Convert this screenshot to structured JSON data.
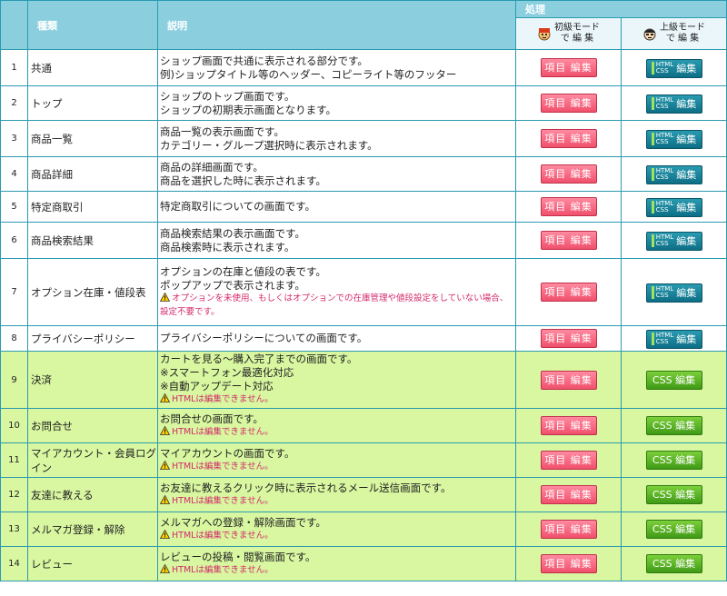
{
  "header": {
    "type": "種類",
    "desc": "説明",
    "process": "処理",
    "beginner": "初級モード\nで 編 集",
    "beginner_l1": "初級モード",
    "beginner_l2": "で 編 集",
    "advanced_l1": "上級モード",
    "advanced_l2": "で 編 集"
  },
  "buttons": {
    "item_edit": "項目 編集",
    "html_tag_1": "HTML",
    "html_tag_2": "CSS",
    "edit": "編集",
    "css_edit": "CSS 編集"
  },
  "rows": [
    {
      "no": "1",
      "type": "共通",
      "desc": [
        "ショップ画面で共通に表示される部分です。",
        "例)ショップタイトル等のヘッダー、コピーライト等のフッター"
      ],
      "warn": "",
      "mode": "html"
    },
    {
      "no": "2",
      "type": "トップ",
      "desc": [
        "ショップのトップ画面です。",
        "ショップの初期表示画面となります。"
      ],
      "warn": "",
      "mode": "html"
    },
    {
      "no": "3",
      "type": "商品一覧",
      "desc": [
        "商品一覧の表示画面です。",
        "カテゴリー・グループ選択時に表示されます。"
      ],
      "warn": "",
      "mode": "html"
    },
    {
      "no": "4",
      "type": "商品詳細",
      "desc": [
        "商品の詳細画面です。",
        "商品を選択した時に表示されます。"
      ],
      "warn": "",
      "mode": "html"
    },
    {
      "no": "5",
      "type": "特定商取引",
      "desc": [
        "特定商取引についての画面です。"
      ],
      "warn": "",
      "mode": "html"
    },
    {
      "no": "6",
      "type": "商品検索結果",
      "desc": [
        "商品検索結果の表示画面です。",
        "商品検索時に表示されます。"
      ],
      "warn": "",
      "mode": "html"
    },
    {
      "no": "7",
      "type": "オプション在庫・値段表",
      "desc": [
        "オプションの在庫と値段の表です。",
        "ポップアップで表示されます。"
      ],
      "warn": "オプションを未使用、もしくはオプションでの在庫管理や値段設定をしていない場合、設定不要です。",
      "mode": "html"
    },
    {
      "no": "8",
      "type": "プライバシーポリシー",
      "desc": [
        "プライバシーポリシーについての画面です。"
      ],
      "warn": "",
      "mode": "html"
    },
    {
      "no": "9",
      "type": "決済",
      "desc": [
        "カートを見る～購入完了までの画面です。",
        "※スマートフォン最適化対応",
        "※自動アップデート対応"
      ],
      "warn": "HTMLは編集できません。",
      "mode": "css"
    },
    {
      "no": "10",
      "type": "お問合せ",
      "desc": [
        "お問合せの画面です。"
      ],
      "warn": "HTMLは編集できません。",
      "mode": "css"
    },
    {
      "no": "11",
      "type": "マイアカウント・会員ログイン",
      "desc": [
        "マイアカウントの画面です。"
      ],
      "warn": "HTMLは編集できません。",
      "mode": "css"
    },
    {
      "no": "12",
      "type": "友達に教える",
      "desc": [
        "お友達に教えるクリック時に表示されるメール送信画面です。"
      ],
      "warn": "HTMLは編集できません。",
      "mode": "css"
    },
    {
      "no": "13",
      "type": "メルマガ登録・解除",
      "desc": [
        "メルマガへの登録・解除画面です。"
      ],
      "warn": "HTMLは編集できません。",
      "mode": "css"
    },
    {
      "no": "14",
      "type": "レビュー",
      "desc": [
        "レビューの投稿・閲覧画面です。"
      ],
      "warn": "HTMLは編集できません。",
      "mode": "css"
    }
  ]
}
